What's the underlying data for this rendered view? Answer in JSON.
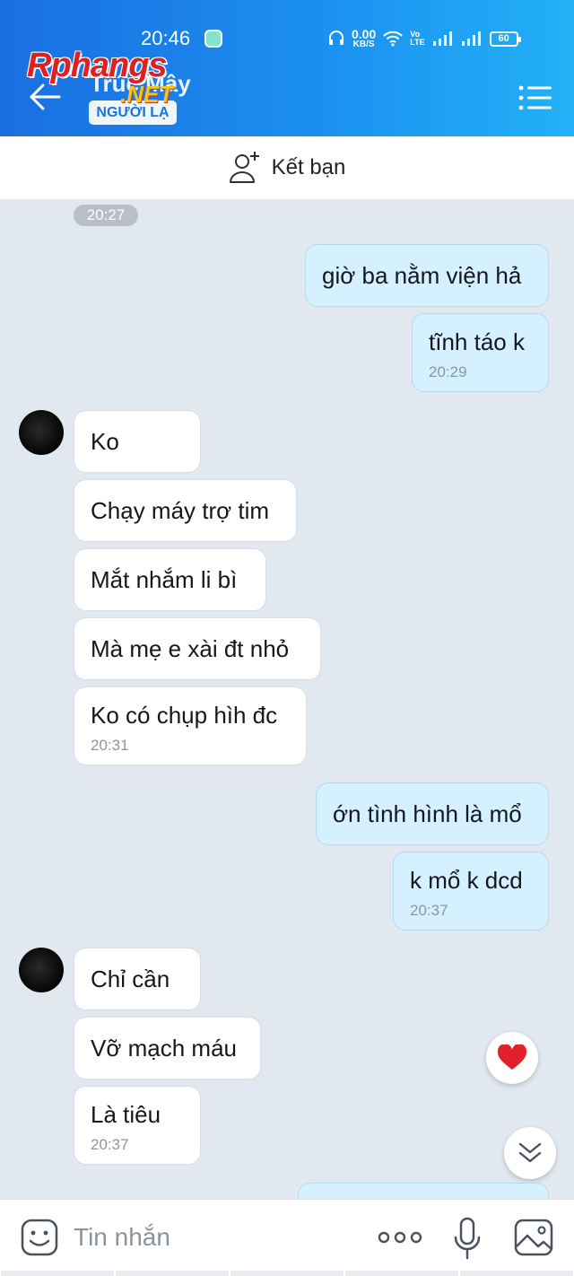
{
  "status_bar": {
    "time": "20:46",
    "net_speed_value": "0.00",
    "net_speed_unit": "KB/S",
    "volte_top": "Vo",
    "volte_bottom": "LTE",
    "battery": "60"
  },
  "header": {
    "contact_name": "Trúc Mây",
    "badge": "NGƯỜI LẠ",
    "watermark_main": "Rphangs",
    "watermark_sub": ".NET",
    "colors": {
      "gradient_start": "#1a6fe0",
      "gradient_end": "#22b1f7"
    }
  },
  "add_friend": {
    "label": "Kết bạn"
  },
  "chat": {
    "timestamp_divider": "20:27",
    "messages": [
      {
        "dir": "out",
        "text": "giờ ba nằm viện hả"
      },
      {
        "dir": "out",
        "text": "tĩnh táo k",
        "time": "20:29"
      },
      {
        "dir": "in",
        "text": "Ko"
      },
      {
        "dir": "in",
        "text": "Chạy máy trợ tim"
      },
      {
        "dir": "in",
        "text": "Mắt nhắm li bì"
      },
      {
        "dir": "in",
        "text": "Mà mẹ e xài đt nhỏ"
      },
      {
        "dir": "in",
        "text": "Ko có chụp hìh đc",
        "time": "20:31"
      },
      {
        "dir": "out",
        "text": "ớn tình hình là mổ"
      },
      {
        "dir": "out",
        "text": "k mổ k dcd",
        "time": "20:37"
      },
      {
        "dir": "in",
        "text": "Chỉ cần"
      },
      {
        "dir": "in",
        "text": "Vỡ mạch máu"
      },
      {
        "dir": "in",
        "text": "Là tiêu",
        "time": "20:37"
      }
    ],
    "colors": {
      "incoming_bg": "#ffffff",
      "outgoing_bg": "#d5f0ff",
      "reaction_heart": "#e0202a"
    }
  },
  "input_bar": {
    "placeholder": "Tin nhắn"
  }
}
